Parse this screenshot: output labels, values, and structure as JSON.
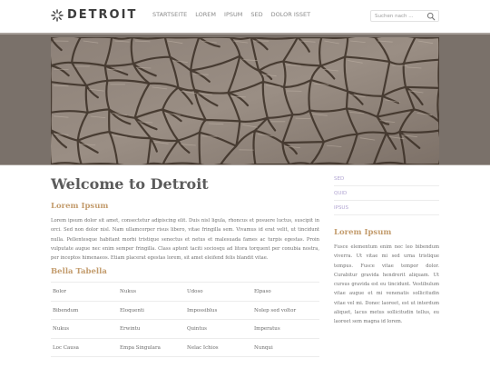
{
  "header": {
    "logo_text": "DETROIT",
    "nav": [
      "STARTSEITE",
      "LOREM",
      "IPSUM",
      "SED",
      "DOLOR ISSET"
    ],
    "search_placeholder": "Suchen nach ..."
  },
  "banner": {
    "icon": "cracked-earth-photo",
    "colors": {
      "frame": "#7a716a",
      "earth": "#8f8379",
      "crack": "#3a2e25"
    }
  },
  "main": {
    "title": "Welcome to Detroit",
    "section1_heading": "Lorem Ipsum",
    "intro": "Lorem ipsum dolor sit amet, consectetur adipiscing elit. Duis nisl ligula, rhoncus et posuere luctus, suscipit in orci. Sed non dolor nisl. Nam ullamcorper risus libero, vitae fringilla sem. Vivamus id erat velit, ut tincidunt nulla. Pellentesque habitant morbi tristique senectus et netus et malesuada fames ac turpis egestas. Proin vulputate augue nec enim semper fringilla. Class aptent taciti sociosqu ad litora torquent per conubia nostra, per inceptos himenaeos. Etiam placerat egestas lorem, sit amet eleifend felis blandit vitae.",
    "section2_heading": "Bella Tabella",
    "table": [
      [
        "Bolor",
        "Nukus",
        "Udoso",
        "Elpaso"
      ],
      [
        "Bibendum",
        "Eloquenti",
        "Impossiblus",
        "Nolep sed voltor"
      ],
      [
        "Nukus",
        "Erwintu",
        "Quintus",
        "Imperatus"
      ],
      [
        "Loc Causa",
        "Empa Singulara",
        "Nelac Ichios",
        "Nunqui"
      ]
    ]
  },
  "sidebar": {
    "nav": [
      "SED",
      "QUID",
      "IPSUS"
    ],
    "heading": "Lorem Ipsum",
    "text": "Fusce elementum enim nec leo bibendum viverra. Ut vitae mi sed urna tristique tempus. Fusce vitae tempor dolor. Curabitur gravida hendrerit aliquam. Ut cursus gravida est eu tincidunt. Vestibulum vitae augue et mi venenatis sollicitudin vitae vel mi. Donec laoreet, est ut interdum aliquet, lacus metus sollicitudin tellus, eu laoreet sem magna id lorem."
  },
  "colors": {
    "accent_heading": "#c39c6d",
    "sidebar_link": "#b1a5d2",
    "title": "#5b5b5b"
  }
}
